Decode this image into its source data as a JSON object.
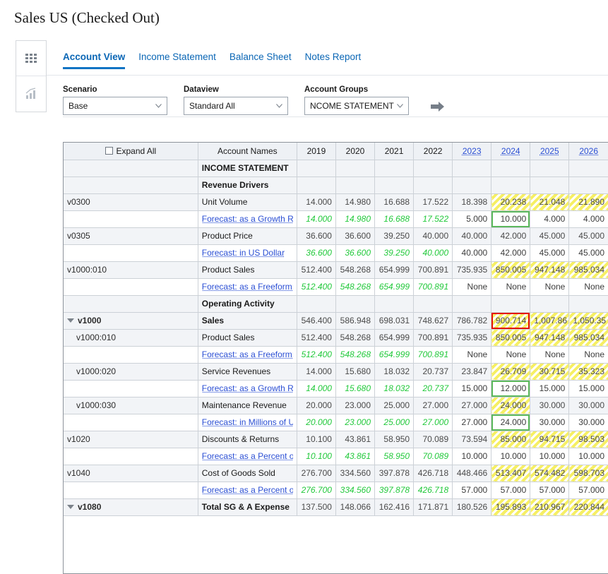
{
  "window": {
    "title": "Sales US (Checked Out)"
  },
  "rail": {
    "items": [
      {
        "name": "grid-view",
        "icon": "grid-icon",
        "active": true
      },
      {
        "name": "chart-view",
        "icon": "chart-icon",
        "active": false
      }
    ]
  },
  "tabs": [
    {
      "label": "Account View",
      "active": true
    },
    {
      "label": "Income Statement",
      "active": false
    },
    {
      "label": "Balance Sheet",
      "active": false
    },
    {
      "label": "Notes Report",
      "active": false
    }
  ],
  "filters": {
    "scenario": {
      "label": "Scenario",
      "value": "Base"
    },
    "dataview": {
      "label": "Dataview",
      "value": "Standard All"
    },
    "account_groups": {
      "label": "Account Groups",
      "value": "NCOME STATEMENT"
    },
    "go_icon": "arrow-right-icon"
  },
  "grid": {
    "expand_all_label": "Expand All",
    "expand_all_checked": false,
    "account_names_header": "Account Names",
    "years": [
      {
        "label": "2019",
        "link": false
      },
      {
        "label": "2020",
        "link": false
      },
      {
        "label": "2021",
        "link": false
      },
      {
        "label": "2022",
        "link": false
      },
      {
        "label": "2023",
        "link": true
      },
      {
        "label": "2024",
        "link": true
      },
      {
        "label": "2025",
        "link": true
      },
      {
        "label": "2026",
        "link": true
      }
    ],
    "highlight_color": "#f6ef64",
    "input_border_color": "#5cb85c",
    "selected_border_color": "#e51400",
    "forecast_text_color": "#22c93b",
    "rows": [
      {
        "type": "section",
        "code": "",
        "name": "INCOME STATEMENT",
        "values": [
          "",
          "",
          "",
          "",
          "",
          "",
          "",
          ""
        ]
      },
      {
        "type": "section",
        "code": "",
        "name": "Revenue Drivers",
        "values": [
          "",
          "",
          "",
          "",
          "",
          "",
          "",
          ""
        ]
      },
      {
        "type": "data",
        "code": "v0300",
        "name": "Unit Volume",
        "values": [
          "14.000",
          "14.980",
          "16.688",
          "17.522",
          "18.398",
          "20.238",
          "21.048",
          "21.890"
        ],
        "hatch": [
          false,
          false,
          false,
          false,
          false,
          true,
          true,
          true
        ]
      },
      {
        "type": "forecast",
        "code": "",
        "name": "Forecast: as a Growth Rate",
        "values": [
          "14.000",
          "14.980",
          "16.688",
          "17.522",
          "5.000",
          "10.000",
          "4.000",
          "4.000"
        ],
        "italic": [
          true,
          true,
          true,
          true,
          false,
          false,
          false,
          false
        ],
        "input_index": 5
      },
      {
        "type": "data",
        "code": "v0305",
        "name": "Product Price",
        "values": [
          "36.600",
          "36.600",
          "39.250",
          "40.000",
          "40.000",
          "42.000",
          "45.000",
          "45.000"
        ],
        "hatch": [
          false,
          false,
          false,
          false,
          false,
          false,
          false,
          false
        ]
      },
      {
        "type": "forecast",
        "code": "",
        "name": "Forecast: in US Dollar",
        "values": [
          "36.600",
          "36.600",
          "39.250",
          "40.000",
          "40.000",
          "42.000",
          "45.000",
          "45.000"
        ],
        "italic": [
          true,
          true,
          true,
          true,
          false,
          false,
          false,
          false
        ],
        "input_index": -1
      },
      {
        "type": "data",
        "code": "v1000:010",
        "name": "Product Sales",
        "values": [
          "512.400",
          "548.268",
          "654.999",
          "700.891",
          "735.935",
          "850.005",
          "947.148",
          "985.034"
        ],
        "hatch": [
          false,
          false,
          false,
          false,
          false,
          true,
          true,
          true
        ]
      },
      {
        "type": "forecast",
        "code": "",
        "name": "Forecast: as a Freeform: US",
        "values": [
          "512.400",
          "548.268",
          "654.999",
          "700.891",
          "None",
          "None",
          "None",
          "None"
        ],
        "italic": [
          true,
          true,
          true,
          true,
          false,
          false,
          false,
          false
        ],
        "input_index": -1
      },
      {
        "type": "section",
        "code": "",
        "name": "Operating Activity",
        "values": [
          "",
          "",
          "",
          "",
          "",
          "",
          "",
          ""
        ]
      },
      {
        "type": "data",
        "code": "v1000",
        "name": "Sales",
        "bold": true,
        "collapse": true,
        "values": [
          "546.400",
          "586.948",
          "698.031",
          "748.627",
          "786.782",
          "900.714",
          "1,007.86",
          "1,050.35"
        ],
        "hatch": [
          false,
          false,
          false,
          false,
          false,
          true,
          true,
          true
        ],
        "selected_index": 5
      },
      {
        "type": "data",
        "code": "v1000:010",
        "name": "Product Sales",
        "indent": 1,
        "values": [
          "512.400",
          "548.268",
          "654.999",
          "700.891",
          "735.935",
          "850.005",
          "947.148",
          "985.034"
        ],
        "hatch": [
          false,
          false,
          false,
          false,
          false,
          true,
          true,
          true
        ]
      },
      {
        "type": "forecast",
        "code": "",
        "name": "Forecast: as a Freeform: US",
        "values": [
          "512.400",
          "548.268",
          "654.999",
          "700.891",
          "None",
          "None",
          "None",
          "None"
        ],
        "italic": [
          true,
          true,
          true,
          true,
          false,
          false,
          false,
          false
        ],
        "input_index": -1
      },
      {
        "type": "data",
        "code": "v1000:020",
        "name": "Service Revenues",
        "indent": 1,
        "values": [
          "14.000",
          "15.680",
          "18.032",
          "20.737",
          "23.847",
          "26.709",
          "30.715",
          "35.323"
        ],
        "hatch": [
          false,
          false,
          false,
          false,
          false,
          true,
          true,
          true
        ]
      },
      {
        "type": "forecast",
        "code": "",
        "name": "Forecast: as a Growth Rate",
        "values": [
          "14.000",
          "15.680",
          "18.032",
          "20.737",
          "15.000",
          "12.000",
          "15.000",
          "15.000"
        ],
        "italic": [
          true,
          true,
          true,
          true,
          false,
          false,
          false,
          false
        ],
        "input_index": 5
      },
      {
        "type": "data",
        "code": "v1000:030",
        "name": "Maintenance Revenue",
        "indent": 1,
        "values": [
          "20.000",
          "23.000",
          "25.000",
          "27.000",
          "27.000",
          "24.000",
          "30.000",
          "30.000"
        ],
        "hatch": [
          false,
          false,
          false,
          false,
          false,
          true,
          false,
          false
        ]
      },
      {
        "type": "forecast",
        "code": "",
        "name": "Forecast: in Millions of US",
        "values": [
          "20.000",
          "23.000",
          "25.000",
          "27.000",
          "27.000",
          "24.000",
          "30.000",
          "30.000"
        ],
        "italic": [
          true,
          true,
          true,
          true,
          false,
          false,
          false,
          false
        ],
        "input_index": 5
      },
      {
        "type": "data",
        "code": "v1020",
        "name": "Discounts & Returns",
        "values": [
          "10.100",
          "43.861",
          "58.950",
          "70.089",
          "73.594",
          "85.000",
          "94.715",
          "98.503"
        ],
        "hatch": [
          false,
          false,
          false,
          false,
          false,
          true,
          true,
          true
        ]
      },
      {
        "type": "forecast",
        "code": "",
        "name": "Forecast: as a Percent of R",
        "values": [
          "10.100",
          "43.861",
          "58.950",
          "70.089",
          "10.000",
          "10.000",
          "10.000",
          "10.000"
        ],
        "italic": [
          true,
          true,
          true,
          true,
          false,
          false,
          false,
          false
        ],
        "input_index": -1
      },
      {
        "type": "data",
        "code": "v1040",
        "name": "Cost of Goods Sold",
        "values": [
          "276.700",
          "334.560",
          "397.878",
          "426.718",
          "448.466",
          "513.407",
          "574.482",
          "598.703"
        ],
        "hatch": [
          false,
          false,
          false,
          false,
          false,
          true,
          true,
          true
        ]
      },
      {
        "type": "forecast",
        "code": "",
        "name": "Forecast: as a Percent of S",
        "values": [
          "276.700",
          "334.560",
          "397.878",
          "426.718",
          "57.000",
          "57.000",
          "57.000",
          "57.000"
        ],
        "italic": [
          true,
          true,
          true,
          true,
          false,
          false,
          false,
          false
        ],
        "input_index": -1
      },
      {
        "type": "data",
        "code": "v1080",
        "name": "Total SG & A Expense",
        "bold": true,
        "collapse": true,
        "values": [
          "137.500",
          "148.066",
          "162.416",
          "171.871",
          "180.526",
          "195.893",
          "210.967",
          "220.844"
        ],
        "hatch": [
          false,
          false,
          false,
          false,
          false,
          true,
          true,
          true
        ]
      }
    ]
  }
}
